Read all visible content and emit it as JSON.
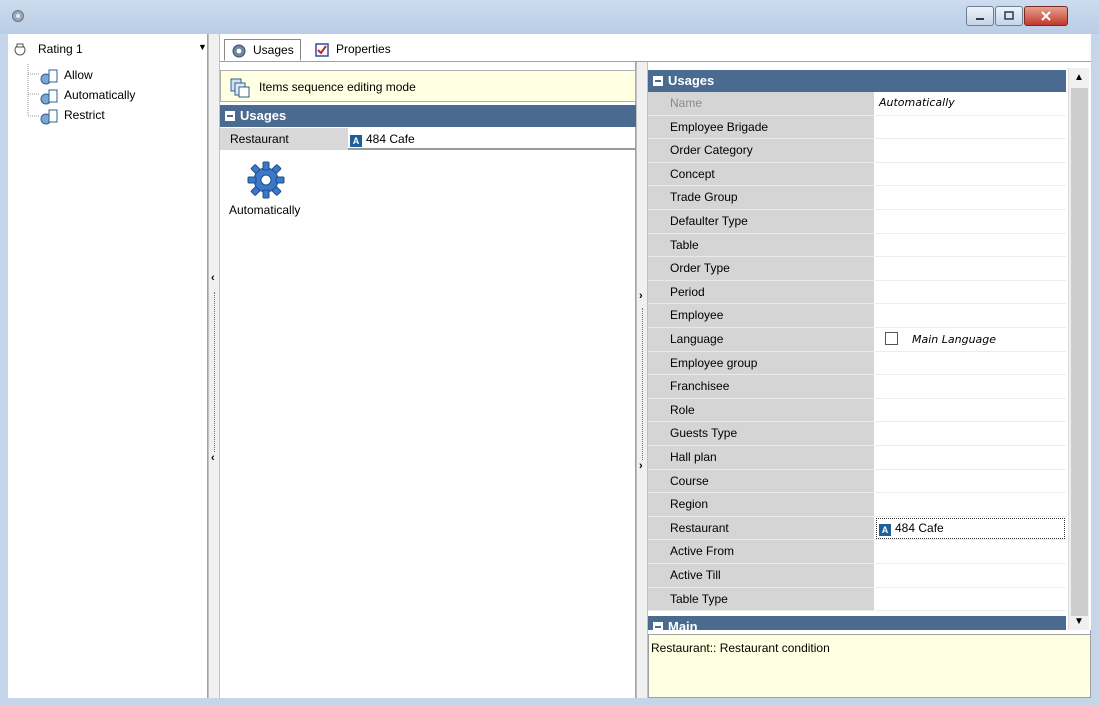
{
  "window": {
    "title": "",
    "icons": {
      "app": "gear-icon",
      "minimize": "minimize-icon",
      "maximize": "maximize-icon",
      "close": "close-icon"
    }
  },
  "left_pane": {
    "rating_value": "Rating 1",
    "tree_items": [
      {
        "label": "Allow"
      },
      {
        "label": "Automatically"
      },
      {
        "label": "Restrict"
      }
    ]
  },
  "tabs": [
    {
      "label": "Usages",
      "icon": "gear-icon",
      "active": true
    },
    {
      "label": "Properties",
      "icon": "checklist-icon",
      "active": false
    }
  ],
  "middle_pane": {
    "sequence_mode_label": "Items sequence editing mode",
    "group_title": "Usages",
    "row": {
      "key": "Restaurant",
      "value": "484 Cafe",
      "badge": "A"
    },
    "item_label": "Automatically"
  },
  "property_grid": {
    "group_title": "Usages",
    "main_group_title": "Main",
    "rows": [
      {
        "key": "Name",
        "value": "Automatically"
      },
      {
        "key": "Employee Brigade",
        "value": ""
      },
      {
        "key": "Order Category",
        "value": ""
      },
      {
        "key": "Concept",
        "value": ""
      },
      {
        "key": "Trade Group",
        "value": ""
      },
      {
        "key": "Defaulter Type",
        "value": ""
      },
      {
        "key": "Table",
        "value": ""
      },
      {
        "key": "Order Type",
        "value": ""
      },
      {
        "key": "Period",
        "value": ""
      },
      {
        "key": "Employee",
        "value": ""
      },
      {
        "key": "Language",
        "value": "Main Language"
      },
      {
        "key": "Employee group",
        "value": ""
      },
      {
        "key": "Franchisee",
        "value": ""
      },
      {
        "key": "Role",
        "value": ""
      },
      {
        "key": "Guests Type",
        "value": ""
      },
      {
        "key": "Hall plan",
        "value": ""
      },
      {
        "key": "Course",
        "value": ""
      },
      {
        "key": "Region",
        "value": ""
      },
      {
        "key": "Restaurant",
        "value": "484 Cafe"
      },
      {
        "key": "Active From",
        "value": ""
      },
      {
        "key": "Active Till",
        "value": ""
      },
      {
        "key": "Table Type",
        "value": ""
      }
    ],
    "restaurant_badge": "A"
  },
  "description": {
    "text": "Restaurant:: Restaurant condition"
  }
}
